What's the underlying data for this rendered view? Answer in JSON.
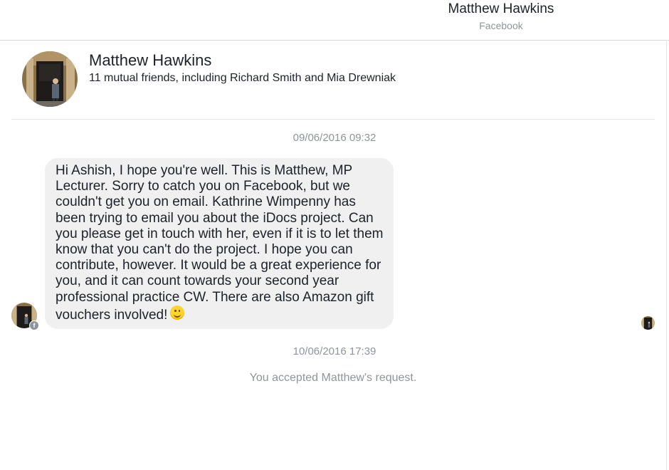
{
  "header": {
    "title": "Matthew Hawkins",
    "subtitle": "Facebook"
  },
  "profile": {
    "name": "Matthew Hawkins",
    "mutual_friends": "11 mutual friends, including Richard Smith and Mia Drewniak"
  },
  "messages": [
    {
      "timestamp": "09/06/2016 09:32",
      "text": "Hi Ashish, I hope you're well.  This is Matthew, MP Lecturer.  Sorry to catch you on Facebook, but we couldn't get you on email.  Kathrine Wimpenny has been trying to email you about the iDocs project.  Can you please get in touch with her, even if it is to let them know that you can't do the project.  I hope you can contribute, however.  It would be a great experience for you, and it can count towards your second year professional practice CW.  There are also Amazon gift vouchers involved!",
      "emoji": "smile-emoji-icon"
    }
  ],
  "system": {
    "timestamp": "10/06/2016 17:39",
    "text": "You accepted Matthew's request."
  },
  "colors": {
    "bubble": "#f1f0f0",
    "muted_text": "#90949c",
    "text": "#1d2129"
  }
}
